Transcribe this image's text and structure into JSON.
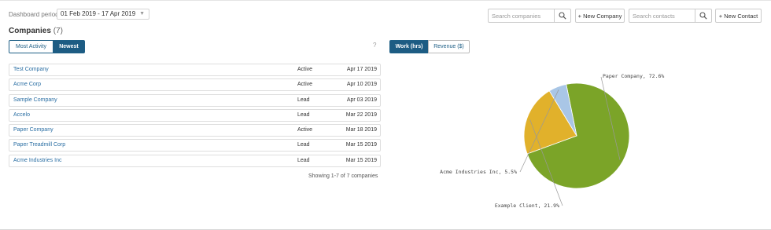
{
  "header": {
    "period_label": "Dashboard period",
    "period_value": "01 Feb 2019 - 17 Apr 2019",
    "search_companies_placeholder": "Search companies",
    "new_company_label": "+ New Company",
    "search_contacts_placeholder": "Search contacts",
    "new_contact_label": "+ New Contact"
  },
  "companies": {
    "title": "Companies",
    "count": "(7)",
    "tabs": [
      "Most Activity",
      "Newest"
    ],
    "active_tab": "Newest",
    "help": "?",
    "rows": [
      {
        "name": "Test Company",
        "status": "Active",
        "date": "Apr 17 2019"
      },
      {
        "name": "Acme Corp",
        "status": "Active",
        "date": "Apr 10 2019"
      },
      {
        "name": "Sample Company",
        "status": "Lead",
        "date": "Apr 03 2019"
      },
      {
        "name": "Accelo",
        "status": "Lead",
        "date": "Mar 22 2019"
      },
      {
        "name": "Paper Company",
        "status": "Active",
        "date": "Mar 18 2019"
      },
      {
        "name": "Paper Treadmill Corp",
        "status": "Lead",
        "date": "Mar 15 2019"
      },
      {
        "name": "Acme Industries Inc",
        "status": "Lead",
        "date": "Mar 15 2019"
      }
    ],
    "showing": "Showing 1-7 of 7 companies"
  },
  "chart_tabs": [
    "Work (hrs)",
    "Revenue ($)"
  ],
  "chart_tab_active": "Work (hrs)",
  "chart_data": {
    "type": "pie",
    "slices": [
      {
        "label": "Paper Company, 72.6%",
        "value": 72.6,
        "color": "#7ba428"
      },
      {
        "label": "Example Client, 21.9%",
        "value": 21.9,
        "color": "#e1b12b"
      },
      {
        "label": "Acme Industries Inc, 5.5%",
        "value": 5.5,
        "color": "#a9c6e6"
      }
    ]
  },
  "colors": {
    "accent": "#1d5c83",
    "link": "#2a6ea3"
  }
}
